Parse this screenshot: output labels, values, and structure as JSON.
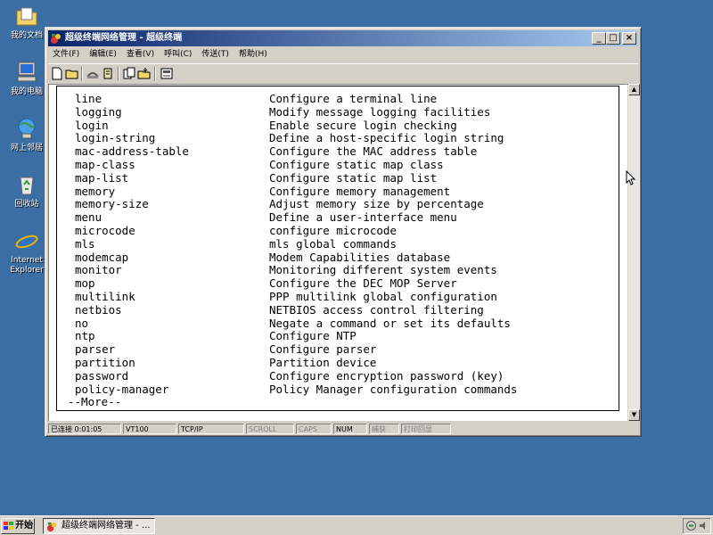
{
  "desktop": {
    "icons": [
      {
        "label": "我的文档",
        "icon": "my-documents-icon"
      },
      {
        "label": "我的电脑",
        "icon": "my-computer-icon"
      },
      {
        "label": "网上邻居",
        "icon": "network-places-icon"
      },
      {
        "label": "回收站",
        "icon": "recycle-bin-icon"
      },
      {
        "label": "Internet Explorer",
        "icon": "internet-explorer-icon"
      }
    ]
  },
  "window": {
    "title": "超级终端网络管理 - 超级终端",
    "controls": {
      "minimize": "_",
      "maximize": "□",
      "close": "×"
    },
    "menu": [
      "文件(F)",
      "编辑(E)",
      "查看(V)",
      "呼叫(C)",
      "传送(T)",
      "帮助(H)"
    ],
    "toolbar": [
      "new-icon",
      "open-icon",
      "disconnect-icon",
      "properties-icon",
      "send-icon",
      "receive-icon",
      "copy-icon"
    ]
  },
  "terminal": {
    "lines": [
      {
        "cmd": "line",
        "desc": "Configure a terminal line"
      },
      {
        "cmd": "logging",
        "desc": "Modify message logging facilities"
      },
      {
        "cmd": "login",
        "desc": "Enable secure login checking"
      },
      {
        "cmd": "login-string",
        "desc": "Define a host-specific login string"
      },
      {
        "cmd": "mac-address-table",
        "desc": "Configure the MAC address table"
      },
      {
        "cmd": "map-class",
        "desc": "Configure static map class"
      },
      {
        "cmd": "map-list",
        "desc": "Configure static map list"
      },
      {
        "cmd": "memory",
        "desc": "Configure memory management"
      },
      {
        "cmd": "memory-size",
        "desc": "Adjust memory size by percentage"
      },
      {
        "cmd": "menu",
        "desc": "Define a user-interface menu"
      },
      {
        "cmd": "microcode",
        "desc": "configure microcode"
      },
      {
        "cmd": "mls",
        "desc": "mls global commands"
      },
      {
        "cmd": "modemcap",
        "desc": "Modem Capabilities database"
      },
      {
        "cmd": "monitor",
        "desc": "Monitoring different system events"
      },
      {
        "cmd": "mop",
        "desc": "Configure the DEC MOP Server"
      },
      {
        "cmd": "multilink",
        "desc": "PPP multilink global configuration"
      },
      {
        "cmd": "netbios",
        "desc": "NETBIOS access control filtering"
      },
      {
        "cmd": "no",
        "desc": "Negate a command or set its defaults"
      },
      {
        "cmd": "ntp",
        "desc": "Configure NTP"
      },
      {
        "cmd": "parser",
        "desc": "Configure parser"
      },
      {
        "cmd": "partition",
        "desc": "Partition device"
      },
      {
        "cmd": "password",
        "desc": "Configure encryption password (key)"
      },
      {
        "cmd": "policy-manager",
        "desc": "Policy Manager configuration commands"
      }
    ],
    "more": "--More--"
  },
  "statusbar": {
    "connection": "已连接 0:01:05",
    "emulation": "VT100",
    "protocol": "TCP/IP",
    "scroll": "SCROLL",
    "caps": "CAPS",
    "num": "NUM",
    "capture": "捕获",
    "print_echo": "打印回显"
  },
  "taskbar": {
    "start_label": "开始",
    "task_label": "超级终端网络管理 - ..."
  }
}
